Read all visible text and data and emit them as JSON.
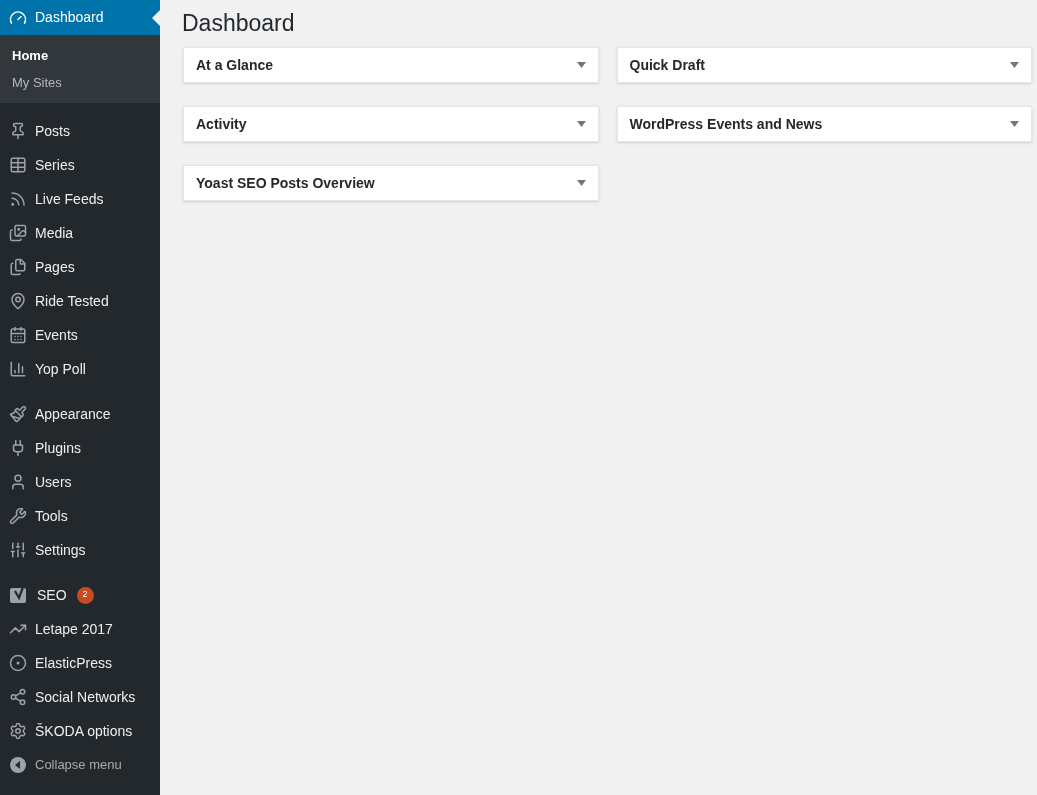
{
  "sidebar": {
    "current": {
      "label": "Dashboard",
      "selected": true
    },
    "submenu": [
      {
        "label": "Home",
        "selected": true
      },
      {
        "label": "My Sites",
        "selected": false
      }
    ],
    "groups": [
      {
        "items": [
          {
            "label": "Posts"
          },
          {
            "label": "Series"
          },
          {
            "label": "Live Feeds"
          },
          {
            "label": "Media"
          },
          {
            "label": "Pages"
          },
          {
            "label": "Ride Tested"
          },
          {
            "label": "Events"
          },
          {
            "label": "Yop Poll"
          }
        ]
      },
      {
        "items": [
          {
            "label": "Appearance"
          },
          {
            "label": "Plugins"
          },
          {
            "label": "Users"
          },
          {
            "label": "Tools"
          },
          {
            "label": "Settings"
          }
        ]
      },
      {
        "items": [
          {
            "label": "SEO",
            "badge": "2"
          },
          {
            "label": "Letape 2017"
          },
          {
            "label": "ElasticPress"
          },
          {
            "label": "Social Networks"
          },
          {
            "label": "ŠKODA options"
          }
        ]
      }
    ],
    "collapse": "Collapse menu"
  },
  "page_title": "Dashboard",
  "columns": [
    {
      "panels": [
        {
          "title": "At a Glance"
        },
        {
          "title": "Activity"
        },
        {
          "title": "Yoast SEO Posts Overview"
        }
      ]
    },
    {
      "panels": [
        {
          "title": "Quick Draft"
        },
        {
          "title": "WordPress Events and News"
        }
      ]
    }
  ]
}
